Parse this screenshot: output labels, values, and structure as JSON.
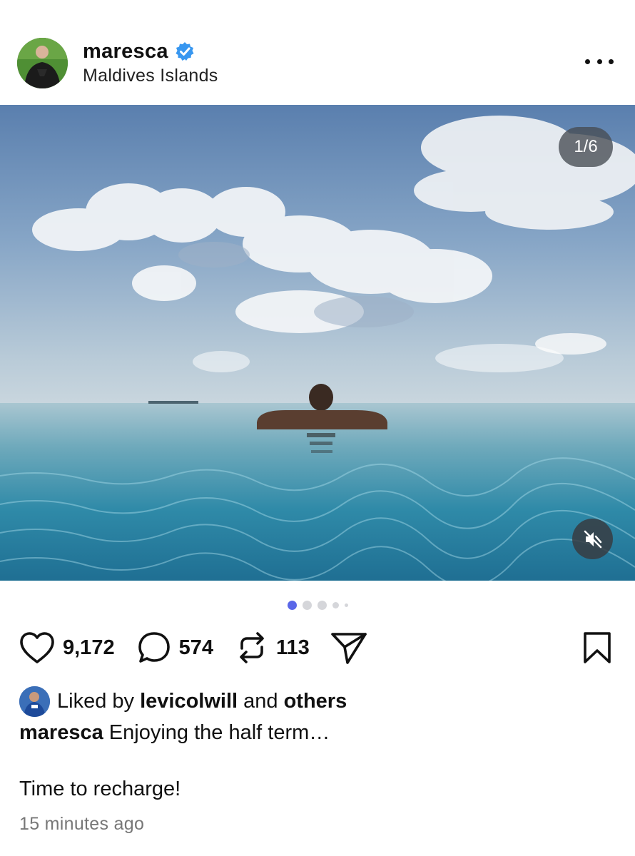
{
  "post": {
    "author": {
      "username": "maresca",
      "verified": true,
      "location": "Maldives Islands"
    },
    "media": {
      "counter": "1/6",
      "current_slide": 1,
      "total_slides": 6,
      "muted": true,
      "description_icon": "muted-speaker-icon"
    },
    "stats": {
      "likes": "9,172",
      "comments": "574",
      "reposts": "113"
    },
    "liked_by": {
      "prefix": "Liked by",
      "user": "levicolwill",
      "middle": "and",
      "others": "others"
    },
    "caption": {
      "username": "maresca",
      "text": "Enjoying the half term…",
      "second_line": "Time to recharge!"
    },
    "timestamp": "15 minutes ago"
  },
  "colors": {
    "accent_dot": "#5a67e8",
    "verified_badge": "#3897f0",
    "text": "#111111",
    "muted_text": "#777777"
  },
  "icons": [
    "more-options-icon",
    "verified-badge-icon",
    "heart-icon",
    "comment-icon",
    "repost-icon",
    "share-icon",
    "bookmark-icon",
    "muted-speaker-icon"
  ]
}
